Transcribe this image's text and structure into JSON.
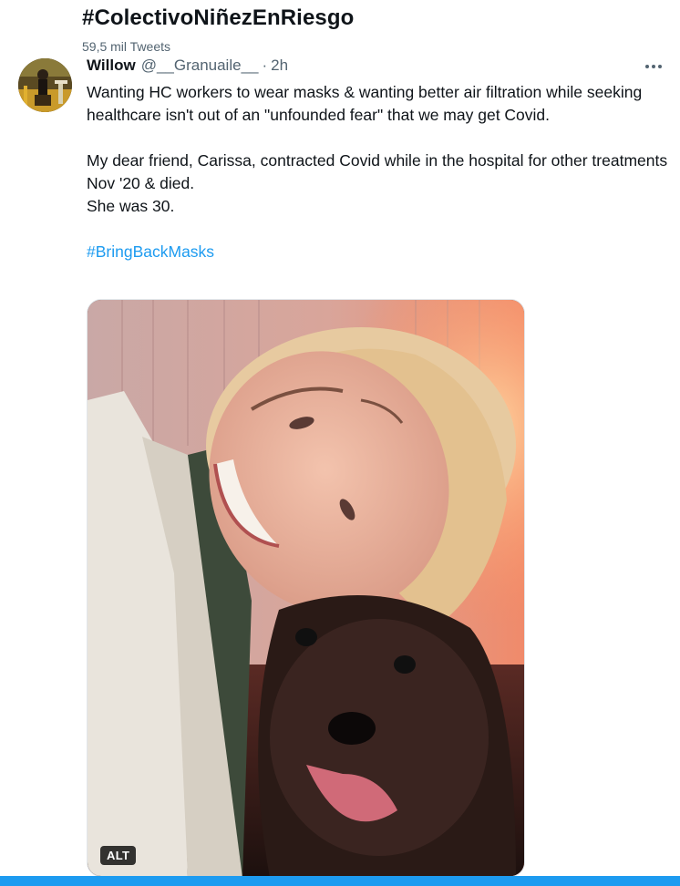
{
  "topbar": {
    "title": "#ColectivoNiñezEnRiesgo",
    "tweet_count": "59,5 mil Tweets"
  },
  "tweet": {
    "author_name": "Willow",
    "author_handle": "@__Granuaile__",
    "separator": "·",
    "time": "2h",
    "more_icon": "more-horizontal-icon",
    "paragraph1": "Wanting HC workers to wear masks & wanting better air filtration while seeking healthcare isn't out of an \"unfounded fear\" that we may get Covid.",
    "paragraph2_line1": "My dear friend, Carissa, contracted Covid while in the hospital for other treatments Nov '20 & died.",
    "paragraph2_line2": "She was 30.",
    "hashtag": "#BringBackMasks",
    "media_alt_label": "ALT"
  },
  "colors": {
    "accent": "#1d9bf0",
    "text_primary": "#0f1419",
    "text_secondary": "#536471"
  }
}
